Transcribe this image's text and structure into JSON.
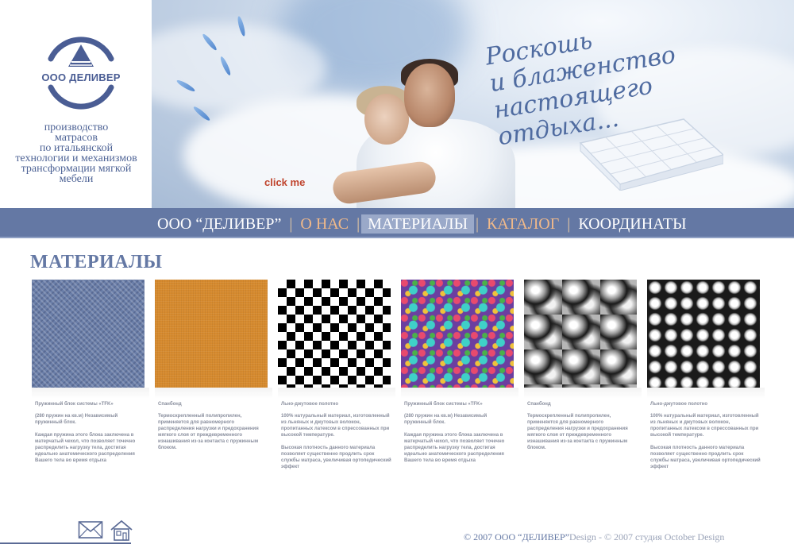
{
  "logo": {
    "name": "ООО ДЕЛИВЕР"
  },
  "tagline": [
    "производство",
    "матрасов",
    "по итальянской",
    "технологии и механизмов",
    "трансформации мягкой",
    "мебели"
  ],
  "hero": {
    "slogan": [
      "Роскошь",
      "и блаженство",
      "настоящего отдыха..."
    ],
    "click_me": "click me"
  },
  "nav": {
    "items": [
      {
        "label": "ООО “ДЕЛИВЕР”",
        "state": "normal"
      },
      {
        "label": "О НАС",
        "state": "highlight"
      },
      {
        "label": "МАТЕРИАЛЫ",
        "state": "active"
      },
      {
        "label": "КАТАЛОГ",
        "state": "highlight"
      },
      {
        "label": "КООРДИНАТЫ",
        "state": "normal"
      }
    ],
    "separator": "|"
  },
  "page": {
    "title": "МАТЕРИАЛЫ"
  },
  "materials": [
    {
      "texture": "blue-knit",
      "title": "Пружинный блок системы «TFK»",
      "desc": "(280 пружин на кв.м) Независимый пружинный блок.\n\nКаждая пружина этого блока заключена в матерчатый чехол, что позволяет точечно распределить нагрузку тела, достигая идеально анатомического распределения Вашего тела во время отдыха"
    },
    {
      "texture": "orange-felt",
      "title": "Спанбонд",
      "desc": "Термоскрепленный полипропилен, применяется для равномерного распределения нагрузки и предохранения мягкого слоя от преждевременного изнашивания из-за контакта с пружинным блоком."
    },
    {
      "texture": "checkerboard",
      "title": "Льно-джутовое полотно",
      "desc": "100% натуральный материал, изготовленный из льняных и джутовых волокон, пропитанных латексом в спрессованных при высокой температуре.\n\nВысокая плотность данного материала позволяет существенно продлить срок службы матраса, увеличивая ортопедический эффект"
    },
    {
      "texture": "colorful",
      "title": "Пружинный блок системы «TFK»",
      "desc": "(280 пружин на кв.м) Независимый пружинный блок.\n\nКаждая пружина этого блока заключена в матерчатый чехол, что позволяет точечно распределить нагрузку тела, достигая идеально анатомического распределения Вашего тела во время отдыха"
    },
    {
      "texture": "silver",
      "title": "Спанбонд",
      "desc": "Термоскрепленный полипропилен, применяется для равномерного распределения нагрузки и предохранения мягкого слоя от преждевременного изнашивания из-за контакта с пружинным блоком."
    },
    {
      "texture": "cells",
      "title": "Льно-джутовое полотно",
      "desc": "100% натуральный материал, изготовленный из льняных и джутовых волокон, пропитанных латексом в спрессованных при высокой температуре.\n\nВысокая плотность данного материала позволяет существенно продлить срок службы матраса, увеличивая ортопедический эффект"
    }
  ],
  "footer": {
    "icons": [
      "mail-icon",
      "home-icon"
    ],
    "copyright_main": "© 2007 ООО “ДЕЛИВЕР”",
    "copyright_design": "Design",
    "copyright_sep": " - ",
    "copyright_studio": "© 2007 студия October Design"
  },
  "colors": {
    "nav_bg": "#6478a4",
    "accent": "#f0b98a",
    "title": "#6478a4",
    "click_me": "#c0452e"
  }
}
